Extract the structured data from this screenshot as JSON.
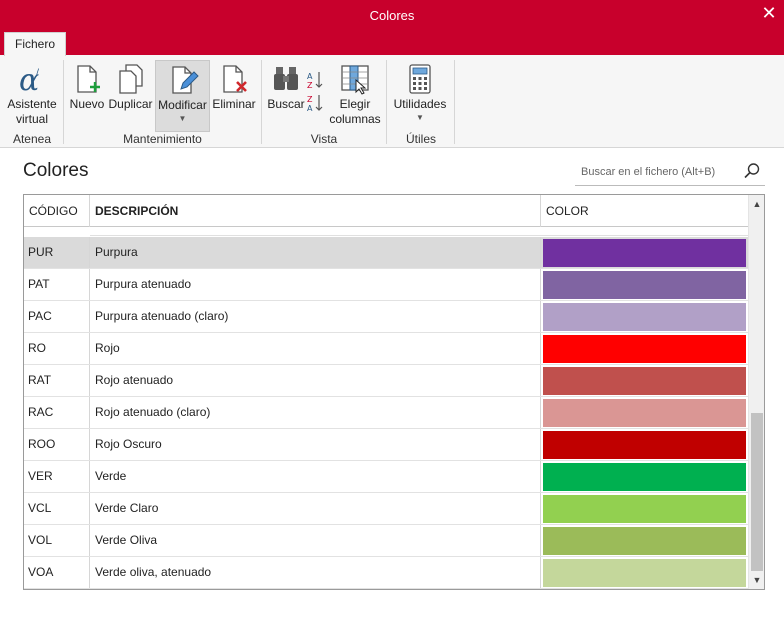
{
  "window": {
    "title": "Colores",
    "close_glyph": "✕"
  },
  "ribbon": {
    "tab": "Fichero",
    "buttons": {
      "asistente": "Asistente virtual",
      "nuevo": "Nuevo",
      "duplicar": "Duplicar",
      "modificar": "Modificar",
      "eliminar": "Eliminar",
      "buscar": "Buscar",
      "elegir": "Elegir columnas",
      "utilidades": "Utilidades"
    },
    "groups": {
      "atenea": "Atenea",
      "mantenimiento": "Mantenimiento",
      "vista": "Vista",
      "utiles": "Útiles"
    },
    "icons": [
      "alpha-icon",
      "new-document-icon",
      "duplicate-icon",
      "edit-document-icon",
      "delete-document-icon",
      "binoculars-icon",
      "sort-icon",
      "choose-columns-icon",
      "calculator-icon"
    ]
  },
  "page": {
    "title": "Colores"
  },
  "search": {
    "placeholder": "Buscar en el fichero (Alt+B)"
  },
  "table": {
    "headers": {
      "code": "CÓDIGO",
      "description": "DESCRIPCIÓN",
      "color": "COLOR"
    },
    "rows": [
      {
        "code": "PUR",
        "description": "Purpura",
        "color": "#7030a0"
      },
      {
        "code": "PAT",
        "description": "Purpura atenuado",
        "color": "#8064a2"
      },
      {
        "code": "PAC",
        "description": "Purpura atenuado (claro)",
        "color": "#b1a0c7"
      },
      {
        "code": "RO",
        "description": "Rojo",
        "color": "#ff0000"
      },
      {
        "code": "RAT",
        "description": "Rojo atenuado",
        "color": "#c0504d"
      },
      {
        "code": "RAC",
        "description": "Rojo atenuado (claro)",
        "color": "#da9694"
      },
      {
        "code": "ROO",
        "description": "Rojo Oscuro",
        "color": "#c00000"
      },
      {
        "code": "VER",
        "description": "Verde",
        "color": "#00b050"
      },
      {
        "code": "VCL",
        "description": "Verde Claro",
        "color": "#92d050"
      },
      {
        "code": "VOL",
        "description": "Verde Oliva",
        "color": "#9bbb59"
      },
      {
        "code": "VOA",
        "description": "Verde oliva, atenuado",
        "color": "#c4d79b"
      }
    ],
    "selected_row": 0
  },
  "colors": {
    "accent": "#c8002c"
  }
}
